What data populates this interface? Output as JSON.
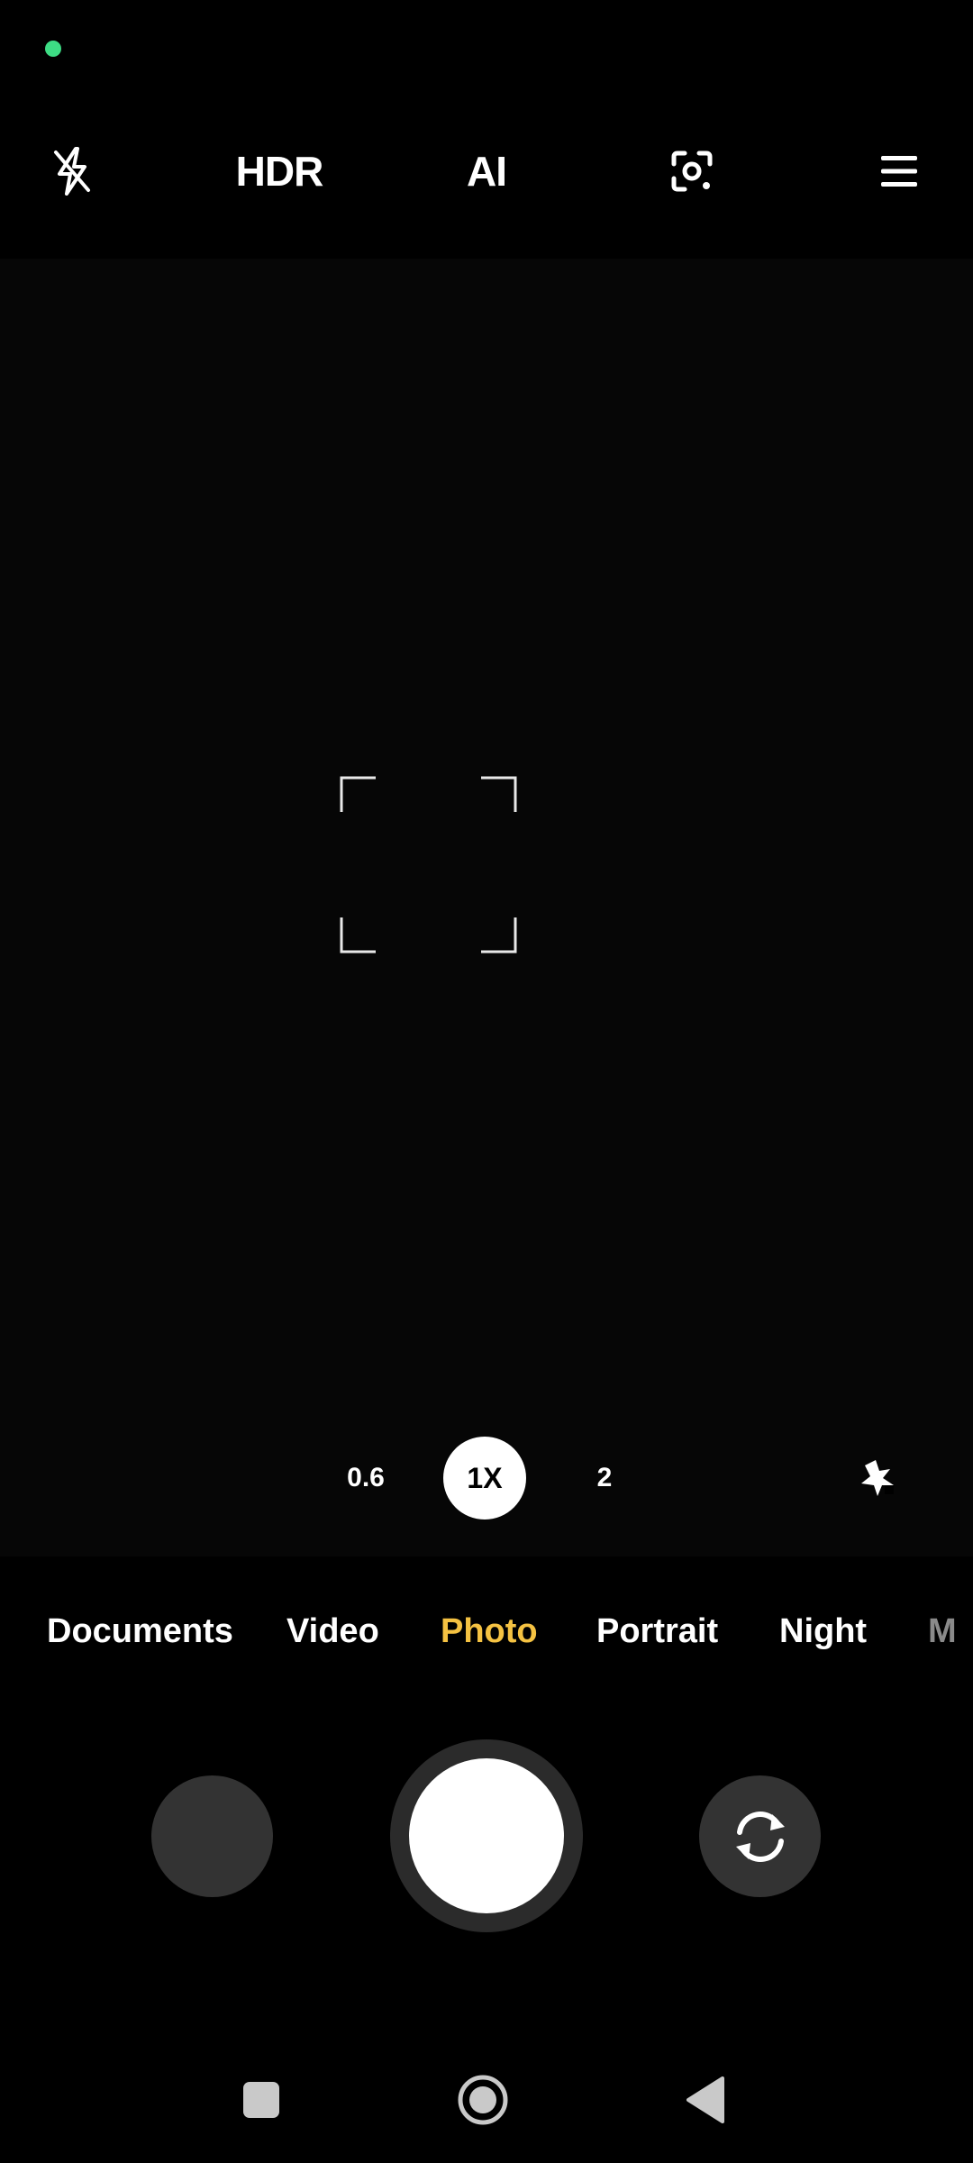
{
  "status_bar": {
    "indicator_color": "#3DDC84"
  },
  "top_bar": {
    "flash": {
      "icon": "flash-off-icon"
    },
    "hdr_label": "HDR",
    "ai_label": "AI",
    "lens": {
      "icon": "google-lens-icon"
    },
    "menu": {
      "icon": "menu-icon"
    }
  },
  "zoom": {
    "options": [
      "0.6",
      "1X",
      "2"
    ],
    "selected": "1X"
  },
  "beauty": {
    "icon": "sparkle-icon"
  },
  "modes": {
    "items": [
      "Documents",
      "Video",
      "Photo",
      "Portrait",
      "Night",
      "M"
    ],
    "active": "Photo",
    "active_color": "#F5C242"
  },
  "controls": {
    "gallery": {
      "icon": "gallery-thumbnail"
    },
    "shutter": {
      "icon": "shutter-icon"
    },
    "flip": {
      "icon": "flip-camera-icon"
    }
  },
  "nav_bar": {
    "recents": {
      "icon": "recents-square-icon"
    },
    "home": {
      "icon": "home-circle-icon"
    },
    "back": {
      "icon": "back-triangle-icon"
    }
  }
}
